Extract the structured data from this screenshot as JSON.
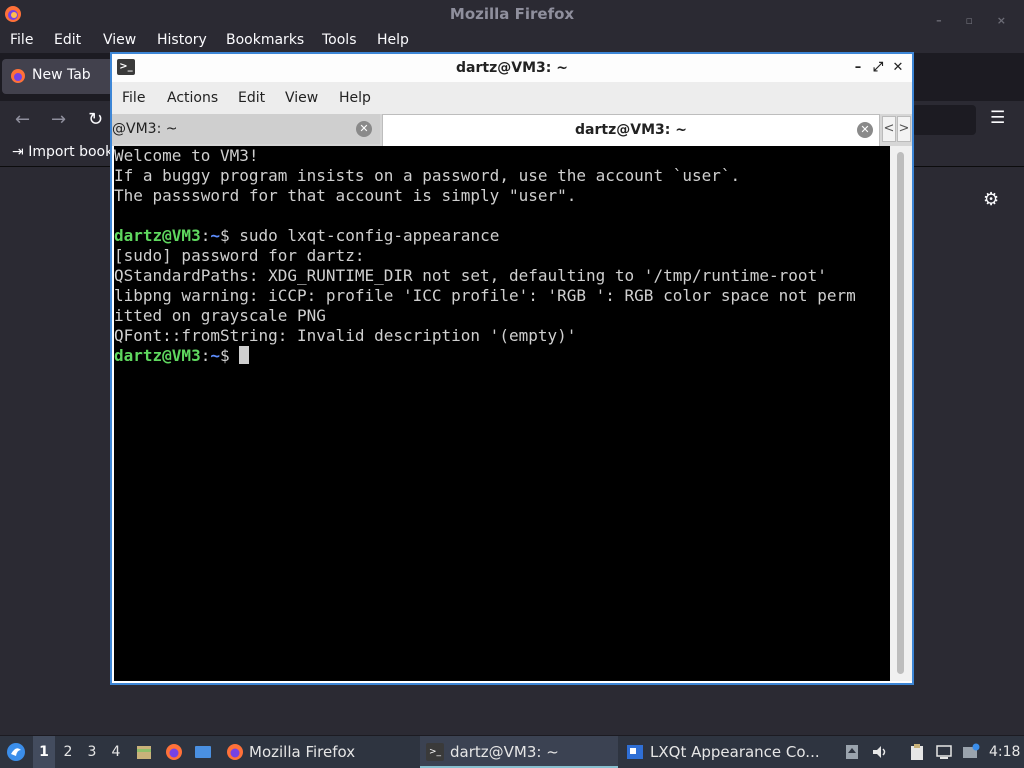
{
  "firefox": {
    "title": "Mozilla Firefox",
    "menu": [
      "File",
      "Edit",
      "View",
      "History",
      "Bookmarks",
      "Tools",
      "Help"
    ],
    "tab_label": "New Tab",
    "import_label": "Import book",
    "window_buttons": "– ▫ ×"
  },
  "terminal": {
    "title": "dartz@VM3: ~",
    "menu": [
      "File",
      "Actions",
      "Edit",
      "View",
      "Help"
    ],
    "tabs": [
      {
        "label": "@VM3: ~"
      },
      {
        "label": "dartz@VM3: ~"
      }
    ],
    "minimize": "–",
    "maximize": "⤢",
    "close": "✕",
    "tab_close": "✕",
    "tab_left": "<",
    "tab_right": ">",
    "lines": [
      "Welcome to VM3!",
      "If a buggy program insists on a password, use the account `user`.",
      "The passsword for that account is simply \"user\".",
      "",
      "[sudo] password for dartz:",
      "QStandardPaths: XDG_RUNTIME_DIR not set, defaulting to '/tmp/runtime-root'",
      "libpng warning: iCCP: profile 'ICC profile': 'RGB ': RGB color space not perm",
      "itted on grayscale PNG",
      "QFont::fromString: Invalid description '(empty)'"
    ],
    "prompt_user": "dartz@VM3",
    "prompt_sep": ":",
    "prompt_path": "~",
    "prompt_dollar": "$ ",
    "command": "sudo lxqt-config-appearance"
  },
  "taskbar": {
    "desktops": [
      "1",
      "2",
      "3",
      "4"
    ],
    "tasks": [
      {
        "label": "Mozilla Firefox"
      },
      {
        "label": "dartz@VM3: ~"
      },
      {
        "label": "LXQt Appearance Co..."
      }
    ],
    "clock": "4:18"
  },
  "colors": {
    "accent": "#3d86d6",
    "prompt_user": "#5fd75f",
    "prompt_path": "#5f8fff"
  }
}
